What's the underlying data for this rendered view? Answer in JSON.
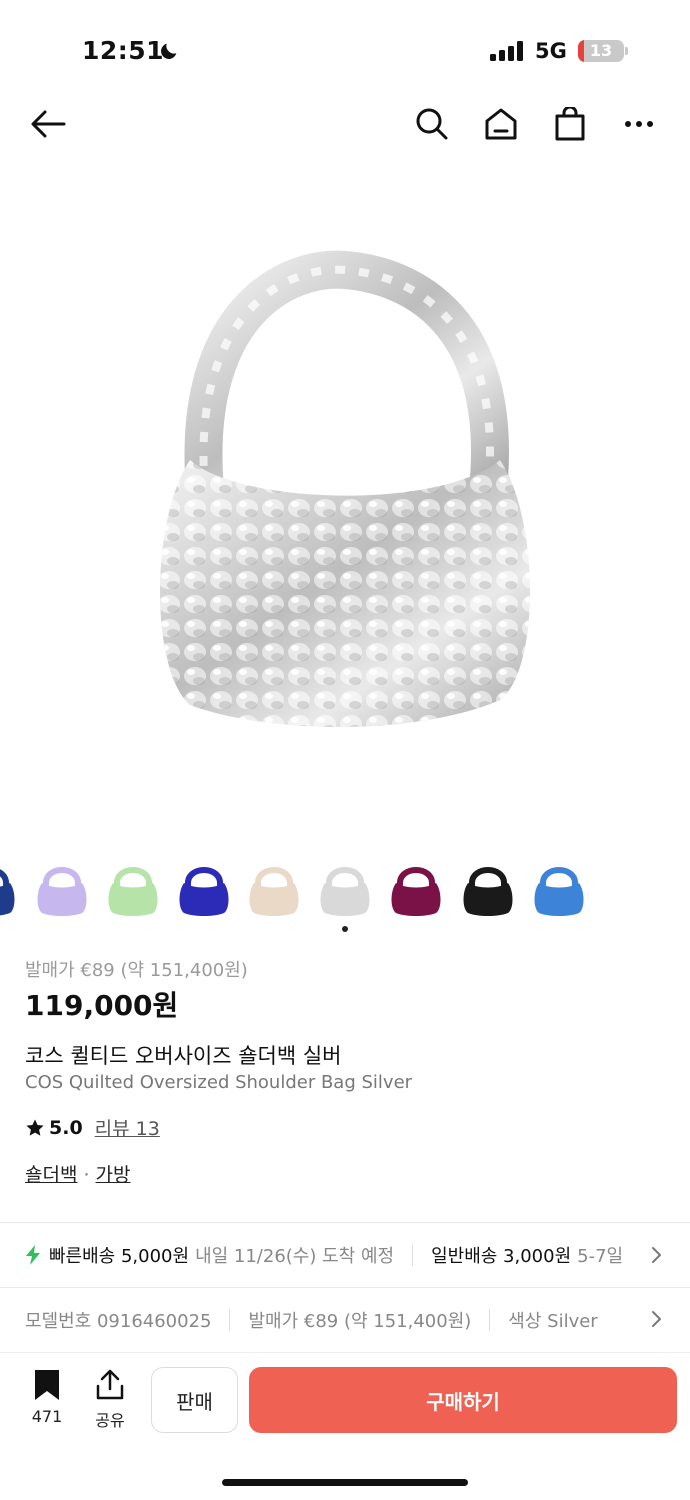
{
  "status_bar": {
    "time": "12:51",
    "network": "5G",
    "battery": "13"
  },
  "nav": {
    "icons": [
      "back-arrow-icon",
      "search-icon",
      "home-icon",
      "shopping-bag-icon",
      "more-icon"
    ]
  },
  "product": {
    "original_price": "발매가 €89 (약 151,400원)",
    "price": "119,000원",
    "name_kr": "코스 퀼티드 오버사이즈 숄더백 실버",
    "name_en": "COS Quilted Oversized Shoulder Bag Silver",
    "rating": "5.0",
    "review_label": "리뷰 13",
    "categories": [
      "숄더백",
      "가방"
    ],
    "category_separator": "·"
  },
  "variants": {
    "colors": [
      "#1f3b8c",
      "#c7b7ef",
      "#b6e3a7",
      "#2b2bb8",
      "#ead9c7",
      "#d9d9d9",
      "#7a1248",
      "#1a1a1a",
      "#3d84d8"
    ],
    "selected_index": 5
  },
  "shipping": {
    "fast_label": "빠른배송 5,000원",
    "fast_eta": "내일 11/26(수) 도착 예정",
    "normal_label": "일반배송 3,000원",
    "normal_eta": "5-7일"
  },
  "meta": {
    "model": "모델번호 0916460025",
    "release_price": "발매가 €89 (약 151,400원)",
    "color": "색상 Silver"
  },
  "bottom_bar": {
    "bookmark_count": "471",
    "share_label": "공유",
    "sell_label": "판매",
    "buy_label": "구매하기",
    "buy_color": "#ef6253"
  }
}
